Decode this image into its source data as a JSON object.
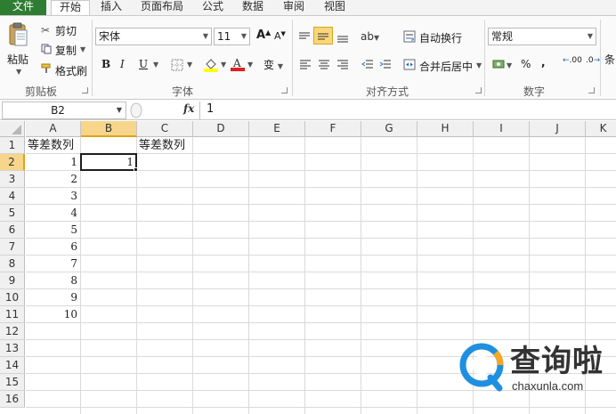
{
  "tabs": [
    "文件",
    "开始",
    "插入",
    "页面布局",
    "公式",
    "数据",
    "审阅",
    "视图"
  ],
  "active_tab": "开始",
  "clipboard": {
    "paste": "粘贴",
    "cut": "剪切",
    "copy": "复制",
    "format_painter": "格式刷",
    "label": "剪贴板"
  },
  "font": {
    "name": "宋体",
    "size": "11",
    "label": "字体",
    "bold": "B",
    "italic": "I",
    "underline": "U",
    "grow": "A",
    "shrink": "A",
    "phonetic": "变"
  },
  "alignment": {
    "wrap_text": "自动换行",
    "merge_center": "合并后居中",
    "label": "对齐方式"
  },
  "number": {
    "format": "常规",
    "percent": "%",
    "comma": ",",
    "inc_decimal": ".00",
    "dec_decimal": ".0",
    "label": "数字"
  },
  "styles": {
    "partial_label": "条"
  },
  "formula_bar": {
    "name_box": "B2",
    "fx": "fx",
    "content": "1"
  },
  "columns": [
    "A",
    "B",
    "C",
    "D",
    "E",
    "F",
    "G",
    "H",
    "I",
    "J",
    "K"
  ],
  "selected_column": "B",
  "rows": [
    "1",
    "2",
    "3",
    "4",
    "5",
    "6",
    "7",
    "8",
    "9",
    "10",
    "11",
    "12",
    "13",
    "14",
    "15",
    "16"
  ],
  "selected_row": "2",
  "cells": {
    "A1": "等差数列",
    "C1": "等差数列",
    "A2": "1",
    "A3": "2",
    "A4": "3",
    "A5": "4",
    "A6": "5",
    "A7": "6",
    "A8": "7",
    "A9": "8",
    "A10": "9",
    "A11": "10",
    "B2": "1"
  },
  "watermark": {
    "title": "查询啦",
    "url": "chaxunla.com"
  },
  "colors": {
    "file_tab": "#2e7d32",
    "selected_header": "#f7d58a",
    "selected_header_border": "#e0a21a",
    "watermark_blue": "#1f8fe0",
    "watermark_orange": "#f5a623"
  }
}
